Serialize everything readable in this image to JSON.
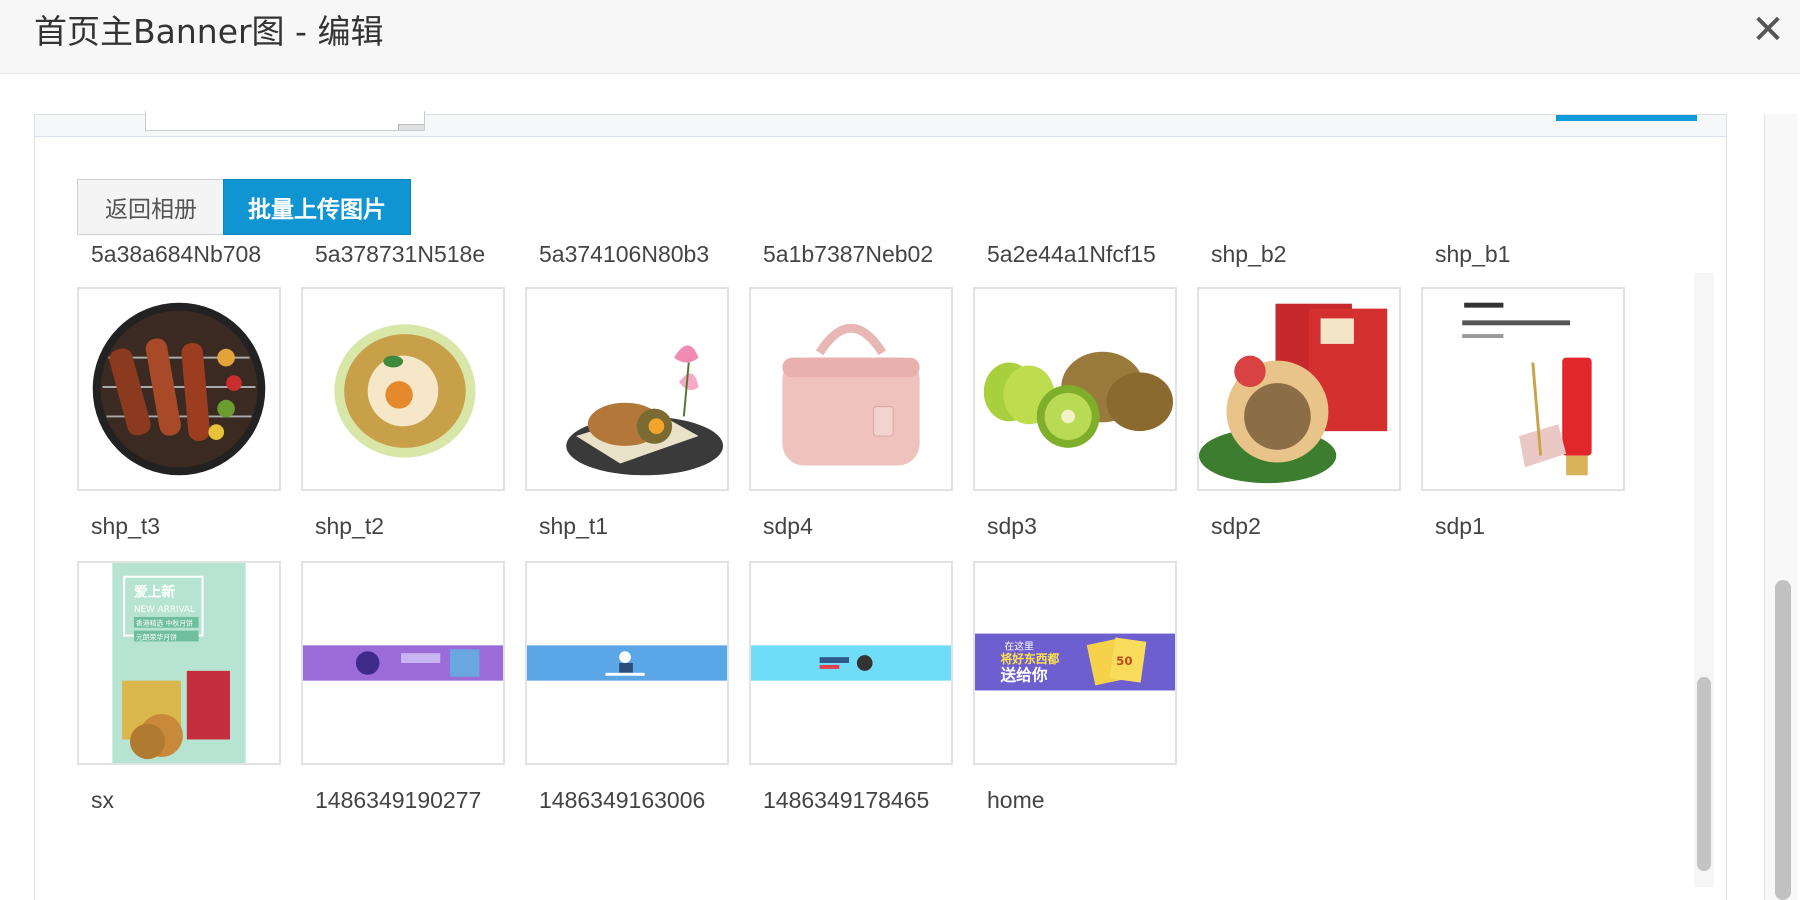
{
  "dialog": {
    "title": "首页主Banner图 - 编辑",
    "close_glyph": "✕"
  },
  "toolbar": {
    "back_label": "返回相册",
    "upload_label": "批量上传图片"
  },
  "colors": {
    "primary": "#1195d2",
    "header_bg": "#f7f7f7"
  },
  "top_row_labels": [
    "5a38a684Nb708",
    "5a378731N518e",
    "5a374106N80b3",
    "5a1b7387Neb02",
    "5a2e44a1Nfcf15",
    "shp_b2",
    "shp_b1"
  ],
  "images": [
    {
      "label": "shp_t3",
      "icon": "bbq-grill-image"
    },
    {
      "label": "shp_t2",
      "icon": "dessert-bowl-image"
    },
    {
      "label": "shp_t1",
      "icon": "mooncake-lotus-image"
    },
    {
      "label": "sdp4",
      "icon": "pink-handbag-image"
    },
    {
      "label": "sdp3",
      "icon": "kiwi-fruit-image"
    },
    {
      "label": "sdp2",
      "icon": "pastry-giftbox-image"
    },
    {
      "label": "sdp1",
      "icon": "cosmetics-ad-image"
    },
    {
      "label": "sx",
      "icon": "new-arrival-poster-image",
      "poster_text": [
        "爱上新",
        "NEW ARRIVAL",
        "香港精选 中秋月饼",
        "元朗荣华月饼"
      ]
    },
    {
      "label": "1486349190277",
      "icon": "purple-banner-image"
    },
    {
      "label": "1486349163006",
      "icon": "blue-banner-image"
    },
    {
      "label": "1486349178465",
      "icon": "cyan-banner-image"
    },
    {
      "label": "home",
      "icon": "coupon-banner-image",
      "banner_text": [
        "在这里",
        "将好东西都",
        "送给你",
        "50"
      ]
    }
  ]
}
